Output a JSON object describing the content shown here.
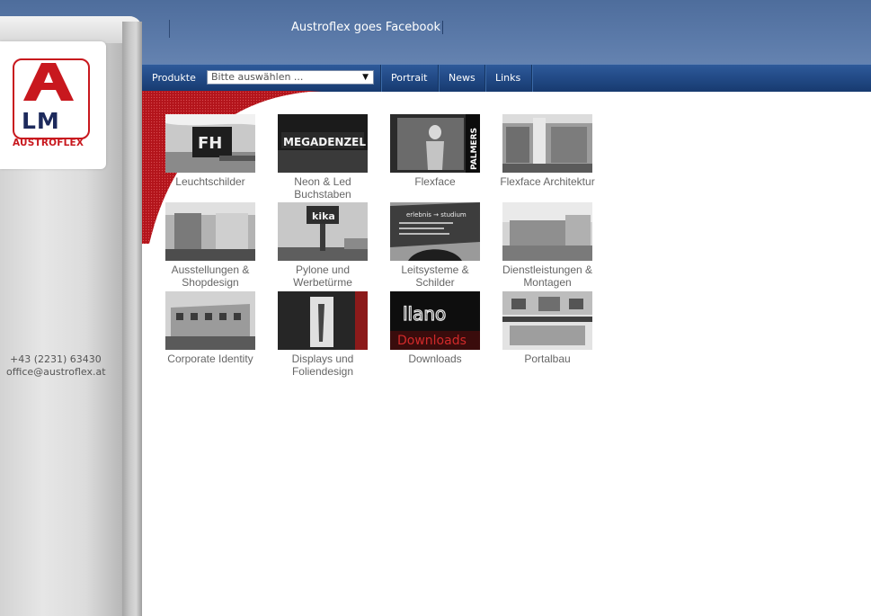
{
  "header": {
    "facebook_link": "Austroflex goes Facebook"
  },
  "nav": {
    "produkte_label": "Produkte",
    "select_value": "Bitte auswählen ...",
    "items": [
      "Portrait",
      "News",
      "Links"
    ]
  },
  "sidebar": {
    "logo_letters": "LM",
    "logo_brand": "AUSTROFLEX",
    "phone": "+43 (2231) 63430",
    "email": "office@austroflex.at"
  },
  "colors": {
    "banner": "#5b7aa9",
    "navbar": "#234b88",
    "brand_red": "#c8181e",
    "brand_navy": "#1d2a5c"
  },
  "products": [
    {
      "label": "Leuchtschilder",
      "icon": "leuchtschilder-thumb"
    },
    {
      "label": "Neon & Led Buchstaben",
      "icon": "neon-led-thumb",
      "sign_text": "MEGADENZEL"
    },
    {
      "label": "Flexface",
      "icon": "flexface-thumb",
      "sign_text": "PALMERS"
    },
    {
      "label": "Flexface Architektur",
      "icon": "flexface-architektur-thumb"
    },
    {
      "label": "Ausstellungen & Shopdesign",
      "icon": "ausstellungen-thumb"
    },
    {
      "label": "Pylone und Werbetürme",
      "icon": "pylone-thumb",
      "sign_text": "kika"
    },
    {
      "label": "Leitsysteme & Schilder",
      "icon": "leitsysteme-thumb",
      "sign_text": "erlebnis → studium"
    },
    {
      "label": "Dienstleistungen & Montagen",
      "icon": "dienstleistungen-thumb"
    },
    {
      "label": "Corporate Identity",
      "icon": "corporate-identity-thumb"
    },
    {
      "label": "Displays und Foliendesign",
      "icon": "displays-thumb"
    },
    {
      "label": "Downloads",
      "icon": "downloads-thumb",
      "sign_text": "Downloads"
    },
    {
      "label": "Portalbau",
      "icon": "portalbau-thumb"
    }
  ]
}
